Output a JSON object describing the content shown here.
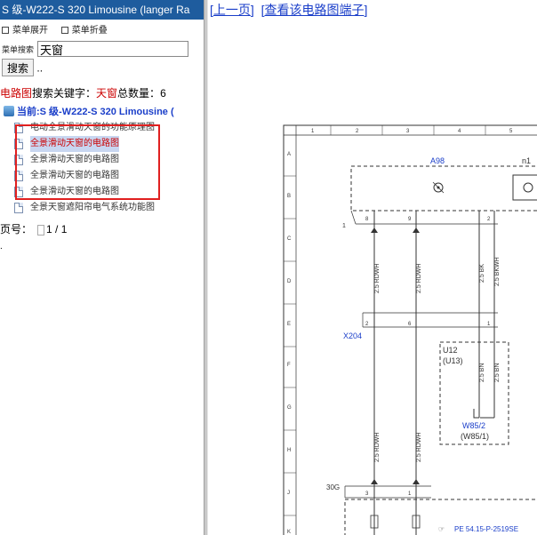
{
  "left": {
    "title": "S 级-W222-S 320 Limousine (langer Ra",
    "expand_label": "菜单展开",
    "collapse_label": "菜单折叠",
    "search_label": "菜单搜索",
    "search_value": "天窗",
    "search_button": "搜索",
    "after_button": "..",
    "summary": {
      "category": "电路图",
      "keyword_label": "搜索关键字：",
      "keyword": "天窗",
      "total_label": "总数量：",
      "total": "6"
    },
    "current": "当前:S 级-W222-S 320 Limousine (",
    "items": [
      {
        "label": "电动全景滑动天窗的功能原理图"
      },
      {
        "label": "全景滑动天窗的电路图"
      },
      {
        "label": "全景滑动天窗的电路图"
      },
      {
        "label": "全景滑动天窗的电路图"
      },
      {
        "label": "全景滑动天窗的电路图"
      },
      {
        "label": "全景天窗遮阳帘电气系统功能图"
      }
    ],
    "pager": {
      "label": "页号：",
      "value": "1 / 1"
    },
    "trail": "."
  },
  "right": {
    "prev_link": "上一页",
    "terminal_link": "查看该电路图端子",
    "diagram": {
      "col_numbers": [
        "1",
        "2",
        "3",
        "4",
        "5",
        "6"
      ],
      "row_letters": [
        "A",
        "B",
        "C",
        "D",
        "E",
        "F",
        "G",
        "H",
        "J",
        "K"
      ],
      "a98": "A98",
      "n1": "n1",
      "x204": "X204",
      "u12a": "U12",
      "u12b": "(U13)",
      "w85a": "W85/2",
      "w85b": "(W85/1)",
      "g30": "30G",
      "one": "1",
      "wire_rdwh": "2.5 RDWH",
      "wire_bk": "2.5 BK",
      "wire_bkwh": "2.5 BKWH",
      "wire_bn": "2.5 BN",
      "pin8": "8",
      "pin9": "9",
      "pin2": "2",
      "pin6": "6",
      "pin1": "1",
      "pin3": "3",
      "ref": "PE 54.15-P-2519SE"
    }
  }
}
